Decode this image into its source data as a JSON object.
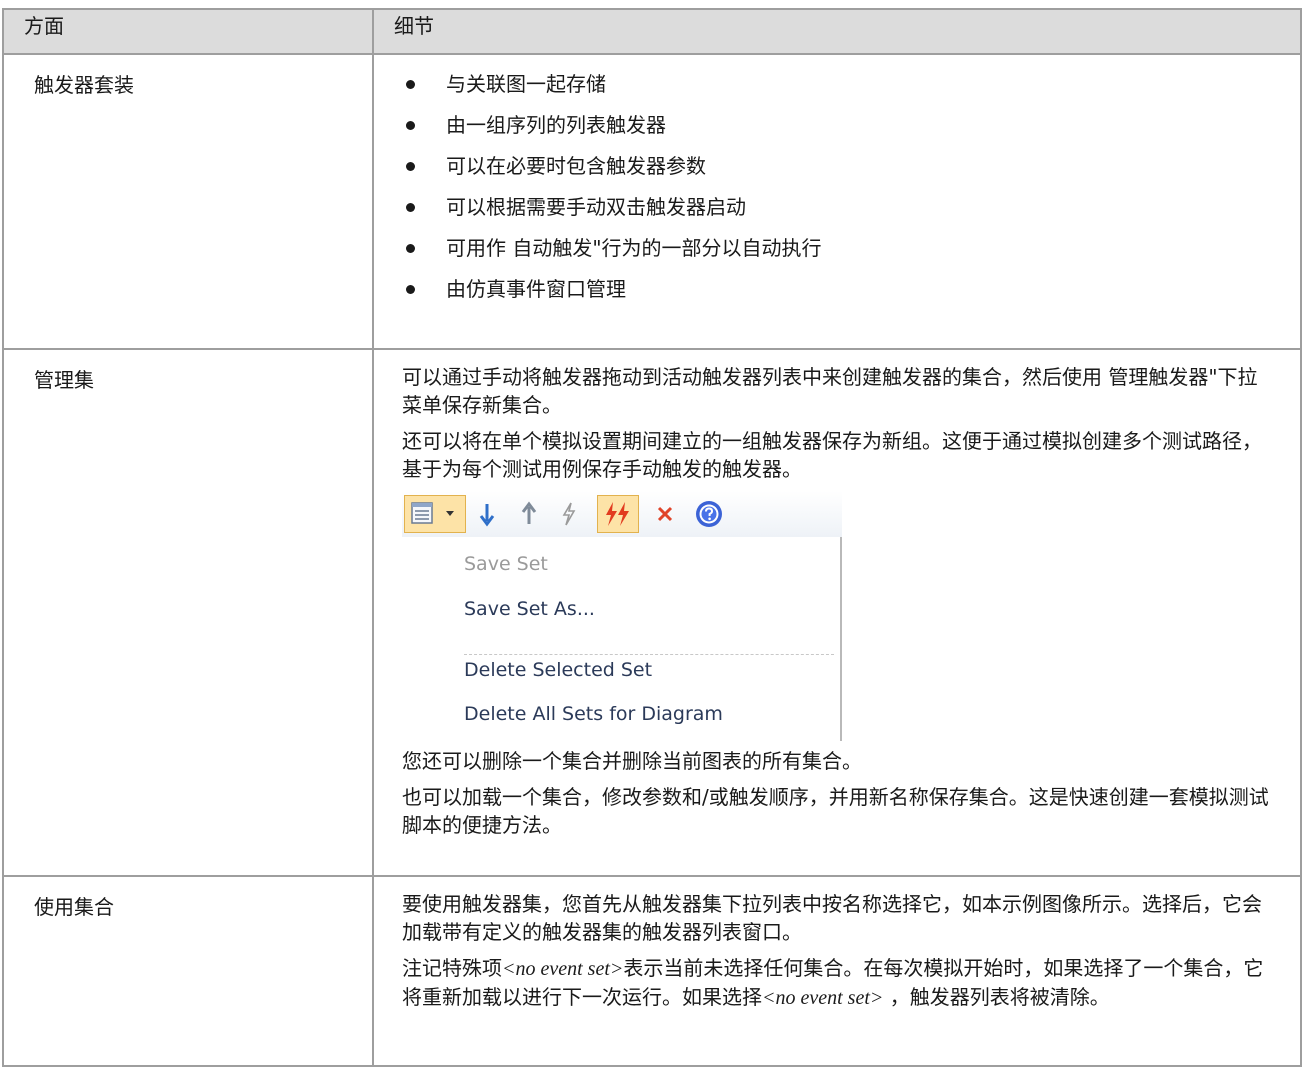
{
  "table": {
    "header": {
      "aspect": "方面",
      "detail": "细节"
    },
    "rows": [
      {
        "aspect": "触发器套装",
        "bullets": [
          "与关联图一起存储",
          "由一组序列的列表触发器",
          "可以在必要时包含触发器参数",
          "可以根据需要手动双击触发器启动",
          "可用作 自动触发\"行为的一部分以自动执行",
          "由仿真事件窗口管理"
        ]
      },
      {
        "aspect": "管理集",
        "para1": "可以通过手动将触发器拖动到活动触发器列表中来创建触发器的集合，然后使用 管理触发器\"下拉菜单保存新集合。",
        "para2": "还可以将在单个模拟设置期间建立的一组触发器保存为新组。这便于通过模拟创建多个测试路径，基于为每个测试用例保存手动触发的触发器。",
        "para3": "您还可以删除一个集合并删除当前图表的所有集合。",
        "para4": "也可以加载一个集合，修改参数和/或触发顺序，并用新名称保存集合。这是快速创建一套模拟测试脚本的便捷方法。"
      },
      {
        "aspect": "使用集合",
        "para1": "要使用触发器集，您首先从触发器集下拉列表中按名称选择它，如本示例图像所示。选择后，它会加载带有定义的触发器集的触发器列表窗口。",
        "para2_a": "注记特殊项",
        "para2_code1": "<no event set>",
        "para2_b": "表示当前未选择任何集合。在每次模拟开始时，如果选择了一个集合，它将重新加载以进行下一次运行。如果选择",
        "para2_code2": "<no event set>",
        "para2_c": " ，触发器列表将被清除。"
      }
    ]
  },
  "menu": {
    "items": [
      {
        "label": "Save Set",
        "enabled": false
      },
      {
        "label": "Save Set As...",
        "enabled": true
      },
      {
        "label": "Delete Selected Set",
        "enabled": true
      },
      {
        "label": "Delete All Sets for Diagram",
        "enabled": true
      }
    ]
  },
  "toolbar_icons": [
    "list-icon",
    "dropdown-arrow-icon",
    "arrow-down-icon",
    "arrow-up-icon",
    "lightning-icon",
    "double-lightning-icon",
    "close-icon",
    "help-icon"
  ],
  "colors": {
    "header_bg": "#dcdcdc",
    "border": "#9e9e9e",
    "menu_text": "#2b3a59",
    "highlight": "#fde3a7"
  }
}
